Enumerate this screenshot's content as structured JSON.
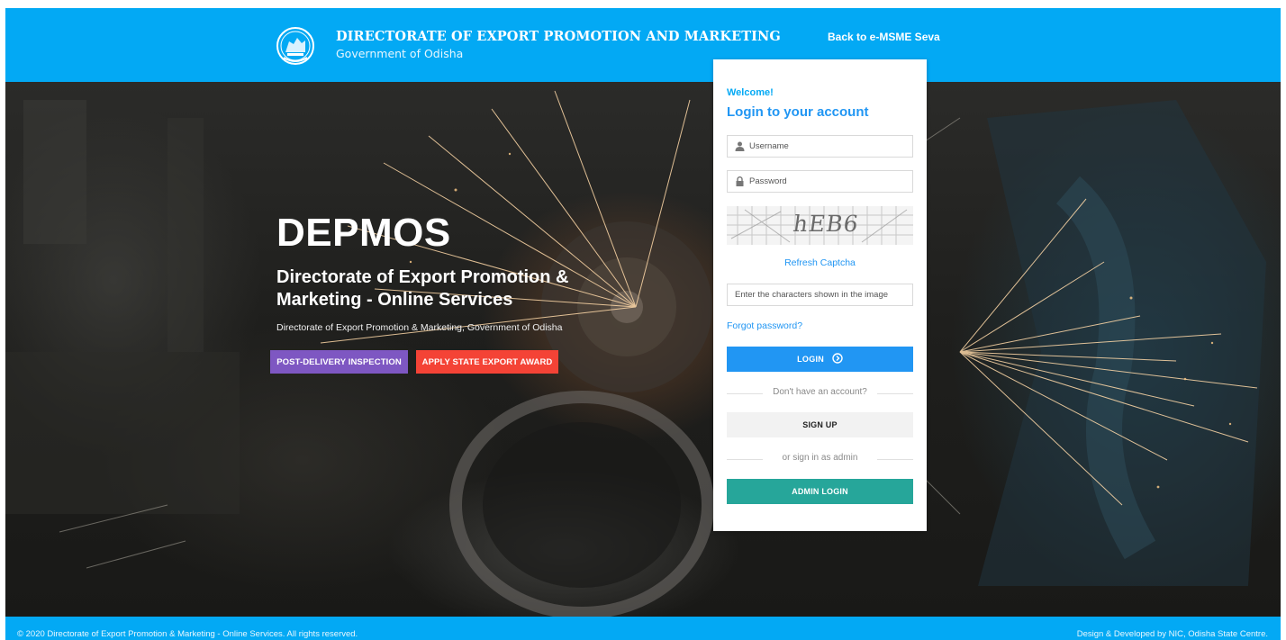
{
  "header": {
    "org_title": "DIRECTORATE OF EXPORT PROMOTION AND MARKETING",
    "org_subtitle": "Government of Odisha",
    "back_link": "Back to e-MSME Seva",
    "emblem_icon": "odisha-emblem-icon"
  },
  "hero": {
    "brand": "DEPMOS",
    "tagline": "Directorate of Export Promotion & Marketing - Online Services",
    "subline": "Directorate of Export Promotion & Marketing, Government of Odisha",
    "buttons": {
      "post_delivery": "POST-DELIVERY INSPECTION",
      "state_award": "APPLY STATE EXPORT AWARD"
    }
  },
  "login": {
    "welcome": "Welcome!",
    "heading": "Login to your account",
    "username_placeholder": "Username",
    "password_placeholder": "Password",
    "captcha_text": "hEB6",
    "refresh_captcha": "Refresh Captcha",
    "captcha_placeholder": "Enter the characters shown in the image",
    "forgot_password": "Forgot password?",
    "login_label": "LOGIN",
    "no_account_text": "Don't have an account?",
    "signup_label": "SIGN UP",
    "admin_divider_text": "or sign in as admin",
    "admin_login_label": "ADMIN LOGIN"
  },
  "footer": {
    "copyright": "© 2020 Directorate of Export Promotion & Marketing - Online Services. All rights reserved.",
    "credit": "Design & Developed by NIC, Odisha State Centre."
  },
  "colors": {
    "header_bg": "#03a9f4",
    "post_delivery_button": "#7e57c2",
    "state_award_button": "#f44336",
    "login_button": "#2196f3",
    "signup_button": "#f2f2f2",
    "admin_button": "#26a69a",
    "link_blue": "#2196f3"
  }
}
